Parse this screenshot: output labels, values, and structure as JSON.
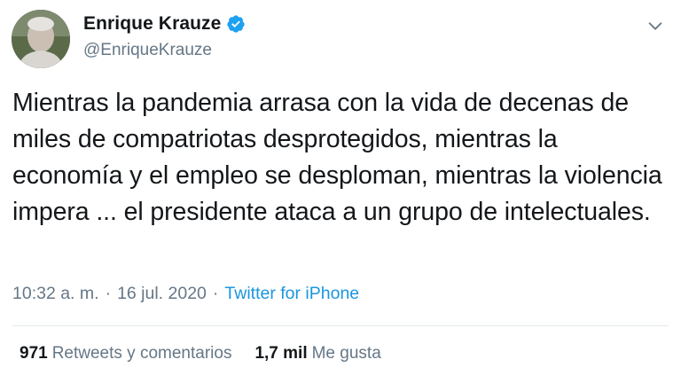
{
  "author": {
    "display_name": "Enrique Krauze",
    "handle": "@EnriqueKrauze",
    "verified_icon": "verified-badge-icon",
    "avatar_icon": "user-avatar"
  },
  "menu": {
    "icon": "chevron-down-icon"
  },
  "tweet": {
    "text": "Mientras la pandemia arrasa con la vida de decenas de miles de compatriotas desprotegidos, mientras la economía y el empleo se desploman, mientras la violencia impera ... el presidente ataca a un grupo de intelectuales."
  },
  "meta": {
    "time": "10:32 a. m.",
    "separator1": "·",
    "date": "16 jul. 2020",
    "separator2": "·",
    "source": "Twitter for iPhone"
  },
  "stats": {
    "retweets_count": "971",
    "retweets_label": "Retweets y comentarios",
    "likes_count": "1,7 mil",
    "likes_label": "Me gusta"
  },
  "colors": {
    "text": "#14171a",
    "secondary": "#657786",
    "link": "#1b95e0",
    "verified": "#1da1f2",
    "divider": "#e1e8ed"
  }
}
